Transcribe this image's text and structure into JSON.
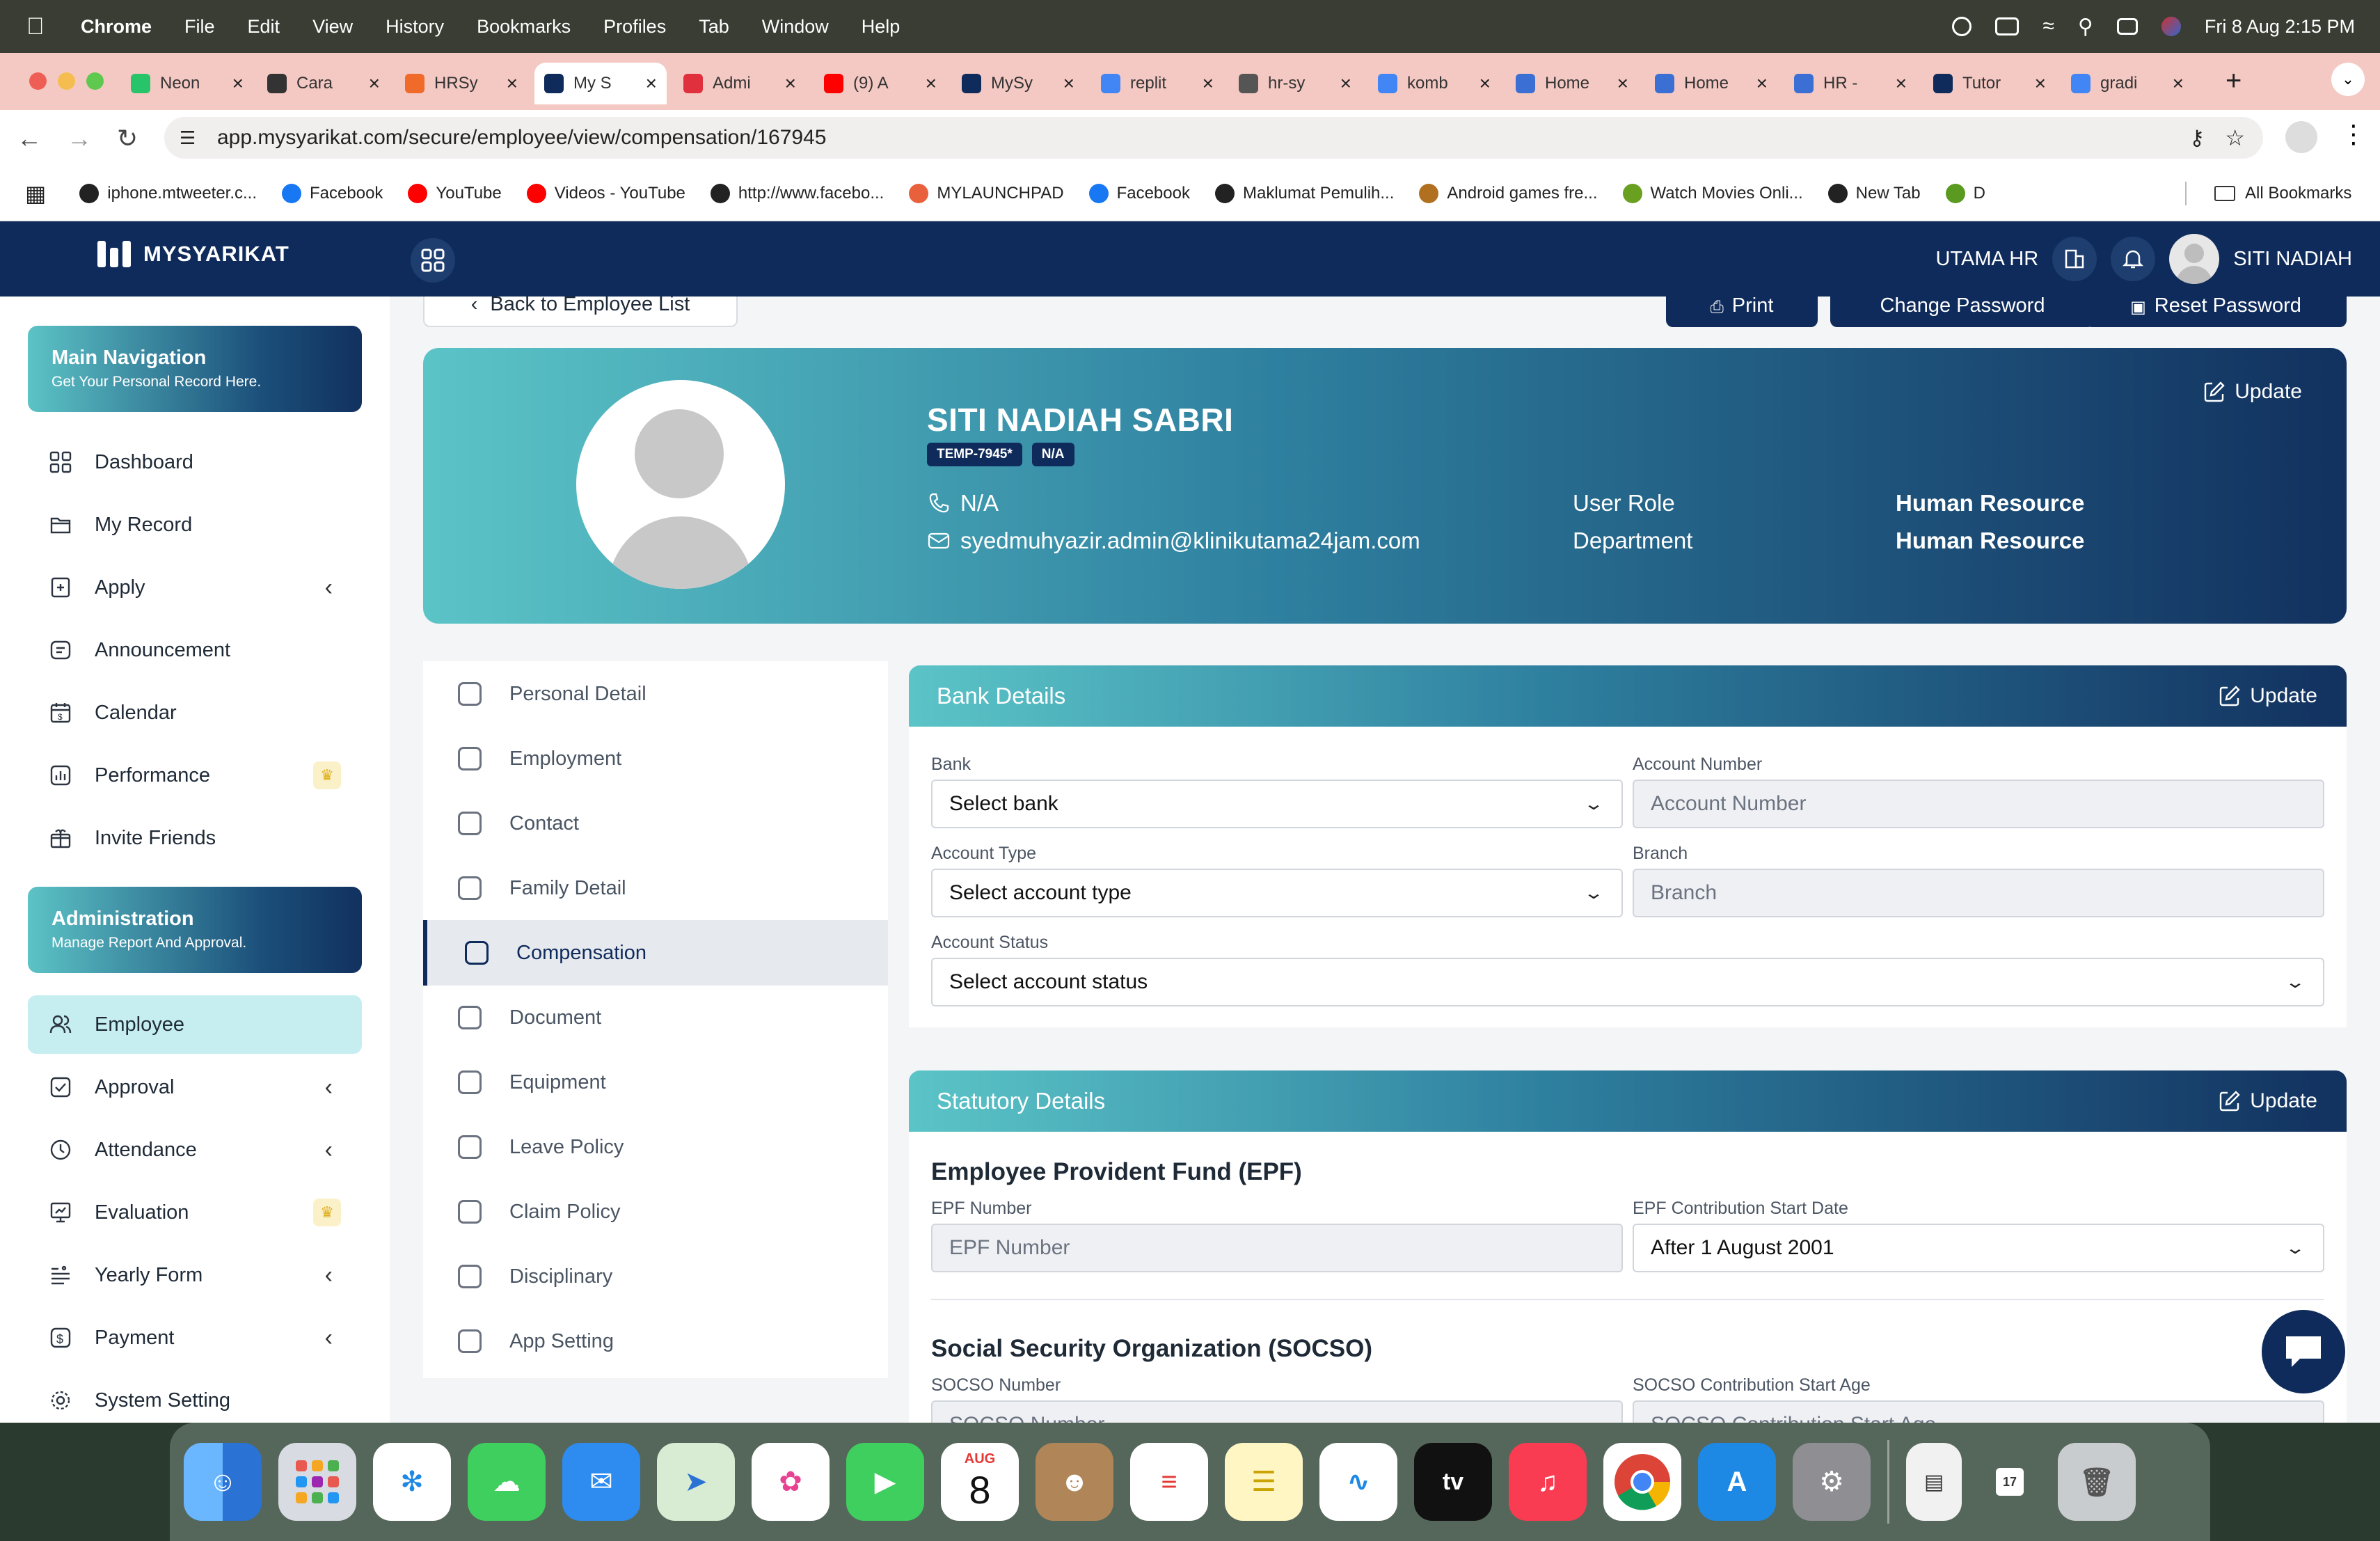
{
  "menubar": {
    "app": "Chrome",
    "items": [
      "File",
      "Edit",
      "View",
      "History",
      "Bookmarks",
      "Profiles",
      "Tab",
      "Window",
      "Help"
    ],
    "clock": "Fri 8 Aug  2:15 PM"
  },
  "tabs": [
    {
      "label": "Neon",
      "color": "#27c46a"
    },
    {
      "label": "Cara",
      "color": "#333333"
    },
    {
      "label": "HRSy",
      "color": "#f06a2a"
    },
    {
      "label": "My S",
      "color": "#0f2b5b"
    },
    {
      "label": "Admi",
      "color": "#e0303e"
    },
    {
      "label": "(9) A",
      "color": "#ff0000"
    },
    {
      "label": "MySy",
      "color": "#0f2b5b"
    },
    {
      "label": "replit",
      "color": "#4285f4"
    },
    {
      "label": "hr-sy",
      "color": "#555555"
    },
    {
      "label": "komb",
      "color": "#4285f4"
    },
    {
      "label": "Home",
      "color": "#3b6fd4"
    },
    {
      "label": "Home",
      "color": "#3b6fd4"
    },
    {
      "label": "HR -",
      "color": "#3b6fd4"
    },
    {
      "label": "Tutor",
      "color": "#0f2b5b"
    },
    {
      "label": "gradi",
      "color": "#4285f4"
    }
  ],
  "address": {
    "url": "app.mysyarikat.com/secure/employee/view/compensation/167945"
  },
  "bookmarks": [
    {
      "label": "iphone.mtweeter.c...",
      "color": "#222222"
    },
    {
      "label": "Facebook",
      "color": "#1877f2"
    },
    {
      "label": "YouTube",
      "color": "#ff0000"
    },
    {
      "label": "Videos - YouTube",
      "color": "#ff0000"
    },
    {
      "label": "http://www.facebo...",
      "color": "#222222"
    },
    {
      "label": "MYLAUNCHPAD",
      "color": "#e8603c"
    },
    {
      "label": "Facebook",
      "color": "#1877f2"
    },
    {
      "label": "Maklumat Pemulih...",
      "color": "#222222"
    },
    {
      "label": "Android games fre...",
      "color": "#b07020"
    },
    {
      "label": "Watch Movies Onli...",
      "color": "#6aa020"
    },
    {
      "label": "New Tab",
      "color": "#222222"
    },
    {
      "label": "D",
      "color": "#5a9a20"
    }
  ],
  "bookmarks_all": "All Bookmarks",
  "app": {
    "brand": "MYSYARIKAT",
    "company": "UTAMA HR",
    "user": "SITI NADIAH"
  },
  "sidebar": {
    "main_title": "Main Navigation",
    "main_sub": "Get Your Personal Record Here.",
    "items": [
      {
        "label": "Dashboard",
        "icon": "dashboard-icon"
      },
      {
        "label": "My Record",
        "icon": "folder-icon"
      },
      {
        "label": "Apply",
        "icon": "apply-icon",
        "chevron": true
      },
      {
        "label": "Announcement",
        "icon": "announcement-icon"
      },
      {
        "label": "Calendar",
        "icon": "calendar-icon"
      },
      {
        "label": "Performance",
        "icon": "performance-icon",
        "crown": true
      },
      {
        "label": "Invite Friends",
        "icon": "gift-icon"
      }
    ],
    "admin_title": "Administration",
    "admin_sub": "Manage Report And Approval.",
    "admin_items": [
      {
        "label": "Employee",
        "icon": "users-icon",
        "active": true
      },
      {
        "label": "Approval",
        "icon": "check-icon",
        "chevron": true
      },
      {
        "label": "Attendance",
        "icon": "clock-icon",
        "chevron": true
      },
      {
        "label": "Evaluation",
        "icon": "evaluation-icon",
        "crown": true
      },
      {
        "label": "Yearly Form",
        "icon": "list-icon",
        "chevron": true
      },
      {
        "label": "Payment",
        "icon": "dollar-icon",
        "chevron": true
      },
      {
        "label": "System Setting",
        "icon": "gear-icon"
      }
    ]
  },
  "actions": {
    "back": "Back to Employee List",
    "print": "Print",
    "change_password": "Change Password",
    "reset_password": "Reset Password"
  },
  "profile": {
    "name": "SITI NADIAH SABRI",
    "badge1": "TEMP-7945*",
    "badge2": "N/A",
    "phone": "N/A",
    "email": "syedmuhyazir.admin@klinikutama24jam.com",
    "role_label": "User Role",
    "role_value": "Human Resource",
    "dept_label": "Department",
    "dept_value": "Human Resource",
    "update": "Update"
  },
  "subnav": [
    {
      "label": "Personal Detail"
    },
    {
      "label": "Employment"
    },
    {
      "label": "Contact"
    },
    {
      "label": "Family Detail"
    },
    {
      "label": "Compensation",
      "active": true
    },
    {
      "label": "Document"
    },
    {
      "label": "Equipment"
    },
    {
      "label": "Leave Policy"
    },
    {
      "label": "Claim Policy"
    },
    {
      "label": "Disciplinary"
    },
    {
      "label": "App Setting"
    }
  ],
  "bank": {
    "title": "Bank Details",
    "update": "Update",
    "bank_label": "Bank",
    "bank_value": "Select bank",
    "account_number_label": "Account Number",
    "account_number_placeholder": "Account Number",
    "account_type_label": "Account Type",
    "account_type_value": "Select account type",
    "branch_label": "Branch",
    "branch_placeholder": "Branch",
    "account_status_label": "Account Status",
    "account_status_value": "Select account status"
  },
  "statutory": {
    "title": "Statutory Details",
    "update": "Update",
    "epf_title": "Employee Provident Fund (EPF)",
    "epf_number_label": "EPF Number",
    "epf_number_placeholder": "EPF Number",
    "epf_start_label": "EPF Contribution Start Date",
    "epf_start_value": "After 1 August 2001",
    "socso_title": "Social Security Organization (SOCSO)",
    "socso_number_label": "SOCSO Number",
    "socso_number_placeholder": "SOCSO Number",
    "socso_start_label": "SOCSO Contribution Start Age",
    "socso_start_value": "SOCSO Contribution Start Age"
  },
  "dock": {
    "calendar_month": "AUG",
    "calendar_day": "8",
    "tv_label": "tv",
    "mini_cal_day": "17"
  }
}
